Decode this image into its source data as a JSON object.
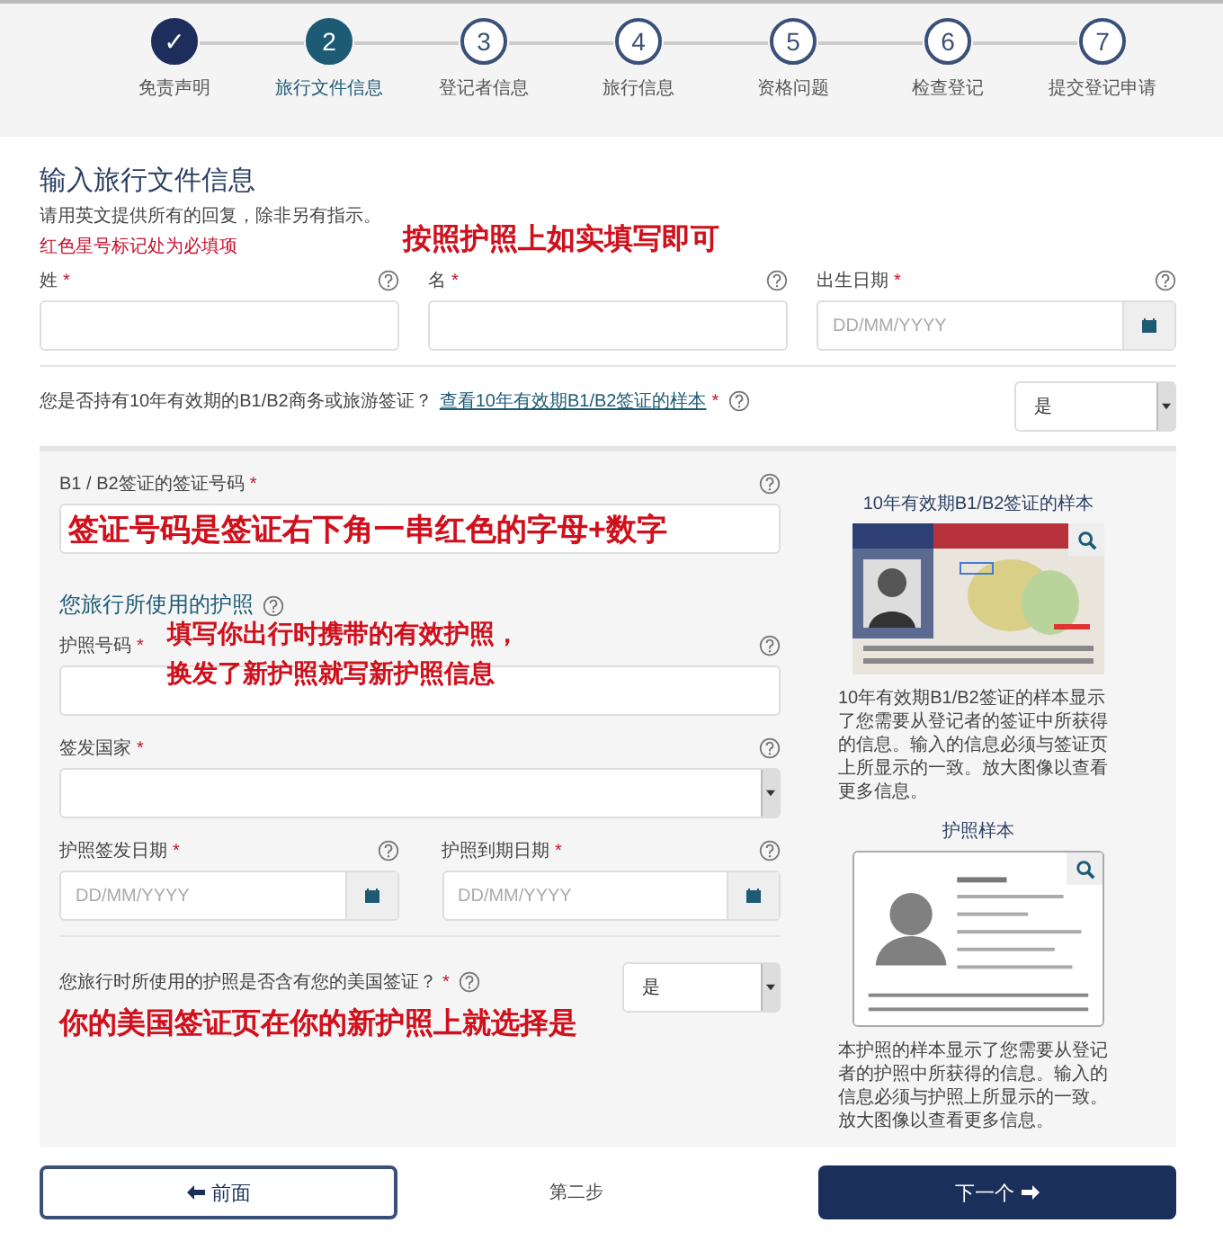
{
  "steps": [
    {
      "marker": "✓",
      "label": "免责声明",
      "completed": true,
      "selected": false
    },
    {
      "marker": "2",
      "label": "旅行文件信息",
      "completed": false,
      "selected": true
    },
    {
      "marker": "3",
      "label": "登记者信息",
      "completed": false,
      "selected": false
    },
    {
      "marker": "4",
      "label": "旅行信息",
      "completed": false,
      "selected": false
    },
    {
      "marker": "5",
      "label": "资格问题",
      "completed": false,
      "selected": false
    },
    {
      "marker": "6",
      "label": "检查登记",
      "completed": false,
      "selected": false
    },
    {
      "marker": "7",
      "label": "提交登记申请",
      "completed": false,
      "selected": false
    }
  ],
  "page_title": "输入旅行文件信息",
  "instructions": "请用英文提供所有的回复，除非另有指示。",
  "required_note": "红色星号标记处为必填项",
  "note": "按照护照上如实填写即可",
  "name_fields": [
    {
      "label": "姓",
      "mark": "*",
      "kind": "text"
    },
    {
      "label": "名",
      "mark": "*",
      "kind": "text"
    },
    {
      "label": "出生日期",
      "mark": "*",
      "kind": "date",
      "placeholder": "DD/MM/YYYY"
    }
  ],
  "visa_question": {
    "text": "您是否持有10年有效期的B1/B2商务或旅游签证？",
    "link": "查看10年有效期B1/B2签证的样本",
    "mark": "*",
    "value": "是"
  },
  "visa_number": {
    "label": "B1 / B2签证的签证号码",
    "mark": "*",
    "value": "签证号码是签证右下角一串红色的字母+数字"
  },
  "passport_heading": "您旅行所使用的护照",
  "passport_note": [
    "填写你出行时携带的有效护照，",
    "换发了新护照就写新护照信息"
  ],
  "passport_number": {
    "label": "护照号码",
    "mark": "*"
  },
  "issuing_country": {
    "label": "签发国家",
    "mark": "*"
  },
  "passport_dates": [
    {
      "label": "护照签发日期",
      "mark": "*",
      "placeholder": "DD/MM/YYYY"
    },
    {
      "label": "护照到期日期",
      "mark": "*",
      "placeholder": "DD/MM/YYYY"
    }
  ],
  "passport_question": {
    "text": "您旅行时所使用的护照是否含有您的美国签证？",
    "mark": "*",
    "value": "是",
    "note": "你的美国签证页在你的新护照上就选择是"
  },
  "samples": [
    {
      "title": "10年有效期B1/B2签证的样本",
      "kind": "visa",
      "description": "10年有效期B1/B2签证的样本显示了您需要从登记者的签证中所获得的信息。输入的信息必须与签证页上所显示的一致。放大图像以查看更多信息。"
    },
    {
      "title": "护照样本",
      "kind": "passport",
      "description": "本护照的样本显示了您需要从登记者的护照中所获得的信息。输入的信息必须与护照上所显示的一致。放大图像以查看更多信息。"
    }
  ],
  "footer": {
    "back": "前面",
    "step": "第二步",
    "next": "下一个"
  }
}
